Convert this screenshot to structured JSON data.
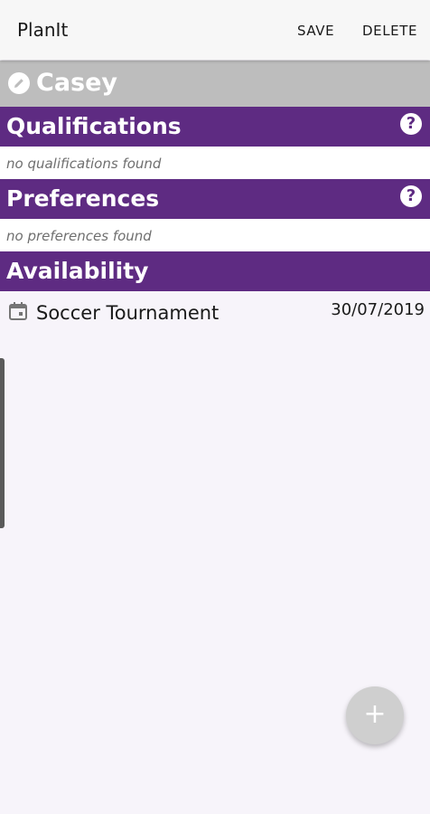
{
  "app_bar": {
    "title": "PlanIt",
    "save_label": "SAVE",
    "delete_label": "DELETE"
  },
  "profile": {
    "name": "Casey",
    "edit_icon": "pencil-icon"
  },
  "qualifications": {
    "title": "Qualifications",
    "help_glyph": "?",
    "empty_text": "no qualifications found"
  },
  "preferences": {
    "title": "Preferences",
    "help_glyph": "?",
    "empty_text": "no preferences found"
  },
  "availability": {
    "title": "Availability",
    "items": [
      {
        "icon": "calendar-icon",
        "title": "Soccer Tournament",
        "date": "30/07/2019"
      }
    ]
  },
  "fab": {
    "glyph": "+"
  },
  "colors": {
    "header_purple": "#5e2b82",
    "name_bar_gray": "#bdbdbd",
    "background": "#f7f4fa",
    "fab_gray": "#cfcfcf"
  }
}
